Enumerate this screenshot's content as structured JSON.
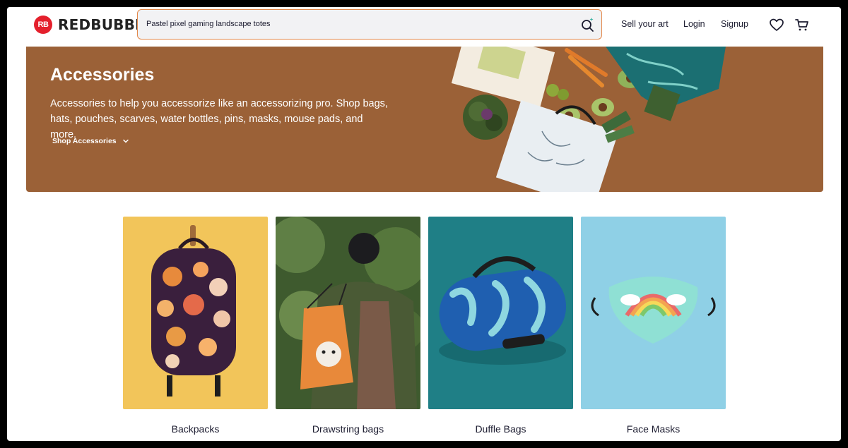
{
  "header": {
    "logo_mark": "RB",
    "logo_text": "REDBUBBLE",
    "search_value": "Pastel pixel gaming landscape totes",
    "nav": {
      "sell": "Sell your art",
      "login": "Login",
      "signup": "Signup"
    }
  },
  "banner": {
    "title": "Accessories",
    "description": "Accessories to help you accessorize like an accessorizing pro. Shop bags, hats, pouches, scarves, water bottles, pins, masks, mouse pads, and more.",
    "link_label": "Shop Accessories",
    "background": "#9b6137"
  },
  "categories": [
    {
      "label": "Backpacks",
      "bg": "#f2c55a"
    },
    {
      "label": "Drawstring bags",
      "bg": "#3e5a2e"
    },
    {
      "label": "Duffle Bags",
      "bg": "#1f7f86"
    },
    {
      "label": "Face Masks",
      "bg": "#8fd0e6"
    }
  ],
  "colors": {
    "brand_red": "#e4202c",
    "search_border": "#e3884a",
    "text_dark": "#1b1b2f"
  }
}
